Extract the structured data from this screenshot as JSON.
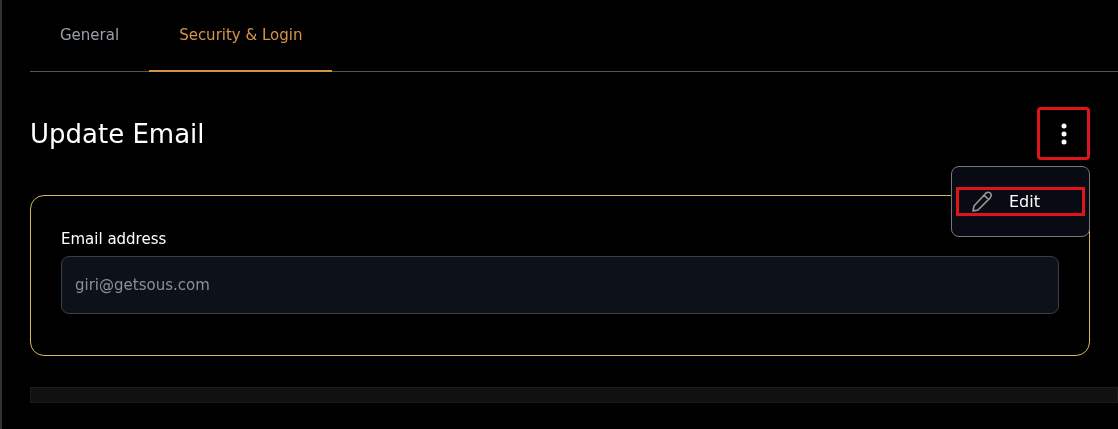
{
  "tabs": [
    {
      "label": "General",
      "selected": false
    },
    {
      "label": "Security & Login",
      "selected": true
    }
  ],
  "section": {
    "title": "Update Email"
  },
  "menu": {
    "items": [
      {
        "label": "Edit"
      }
    ]
  },
  "form": {
    "field": {
      "label": "Email address",
      "value": "giri@getsous.com",
      "disabled": true
    }
  }
}
